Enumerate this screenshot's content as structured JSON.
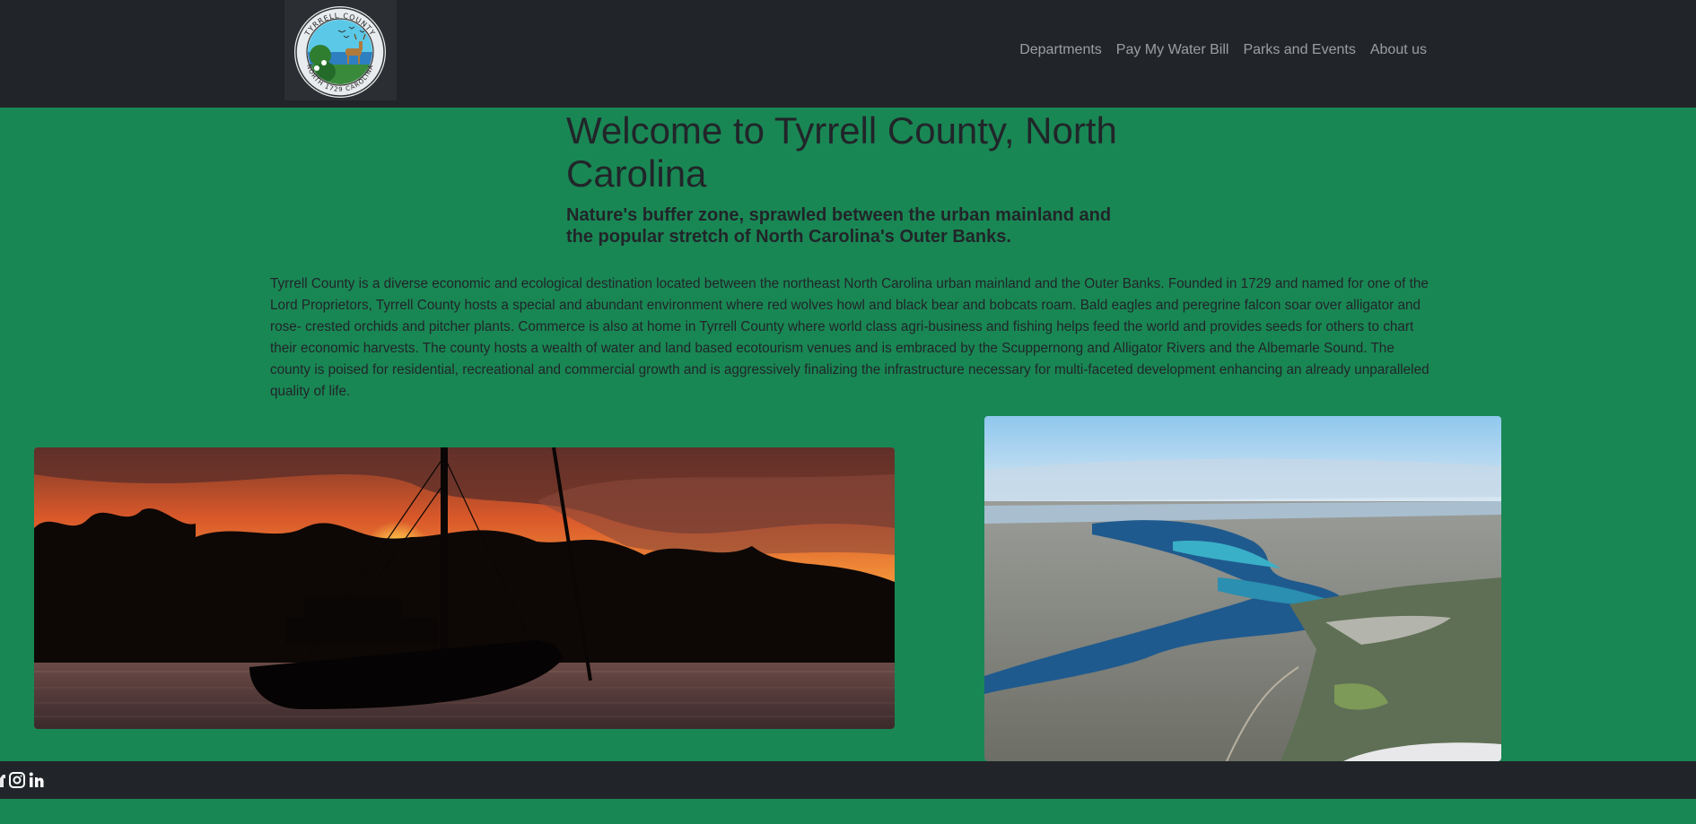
{
  "header": {
    "logo": {
      "icon": "tyrrell-county-seal-icon",
      "seal_top_text": "TYRRELL COUNTY",
      "seal_bottom_text": "NORTH 1729 CAROLINA"
    },
    "nav": [
      {
        "label": "Departments"
      },
      {
        "label": "Pay My Water Bill"
      },
      {
        "label": "Parks and Events"
      },
      {
        "label": "About us"
      }
    ]
  },
  "hero": {
    "title": "Welcome to Tyrrell County, North Carolina",
    "subtitle": "Nature's buffer zone, sprawled between the urban mainland and the popular stretch of North Carolina's Outer Banks."
  },
  "intro": {
    "text": "Tyrrell County is a diverse economic and ecological destination located between the northeast North Carolina urban mainland and the Outer Banks. Founded in 1729 and named for one of the Lord Proprietors, Tyrrell County hosts a special and abundant environment where red wolves howl and black bear and bobcats roam. Bald eagles and peregrine falcon soar over alligator and rose- crested orchids and pitcher plants. Commerce is also at home in Tyrrell County where world class agri-business and fishing helps feed the world and provides seeds for others to chart their economic harvests. The county hosts a wealth of water and land based ecotourism venues and is embraced by the Scuppernong and Alligator Rivers and the Albemarle Sound. The county is poised for residential, recreational and commercial growth and is aggressively finalizing the infrastructure necessary for multi-faceted development enhancing an already unparalleled quality of life."
  },
  "gallery": [
    {
      "icon": "sailboat-sunset-photo"
    },
    {
      "icon": "aerial-river-photo"
    }
  ],
  "footer": {
    "social": [
      {
        "icon": "facebook-icon"
      },
      {
        "icon": "instagram-icon"
      },
      {
        "icon": "linkedin-icon"
      }
    ]
  },
  "colors": {
    "page_bg": "#198754",
    "nav_bg": "#212529",
    "nav_link": "rgba(255,255,255,0.55)",
    "text": "#212529"
  }
}
